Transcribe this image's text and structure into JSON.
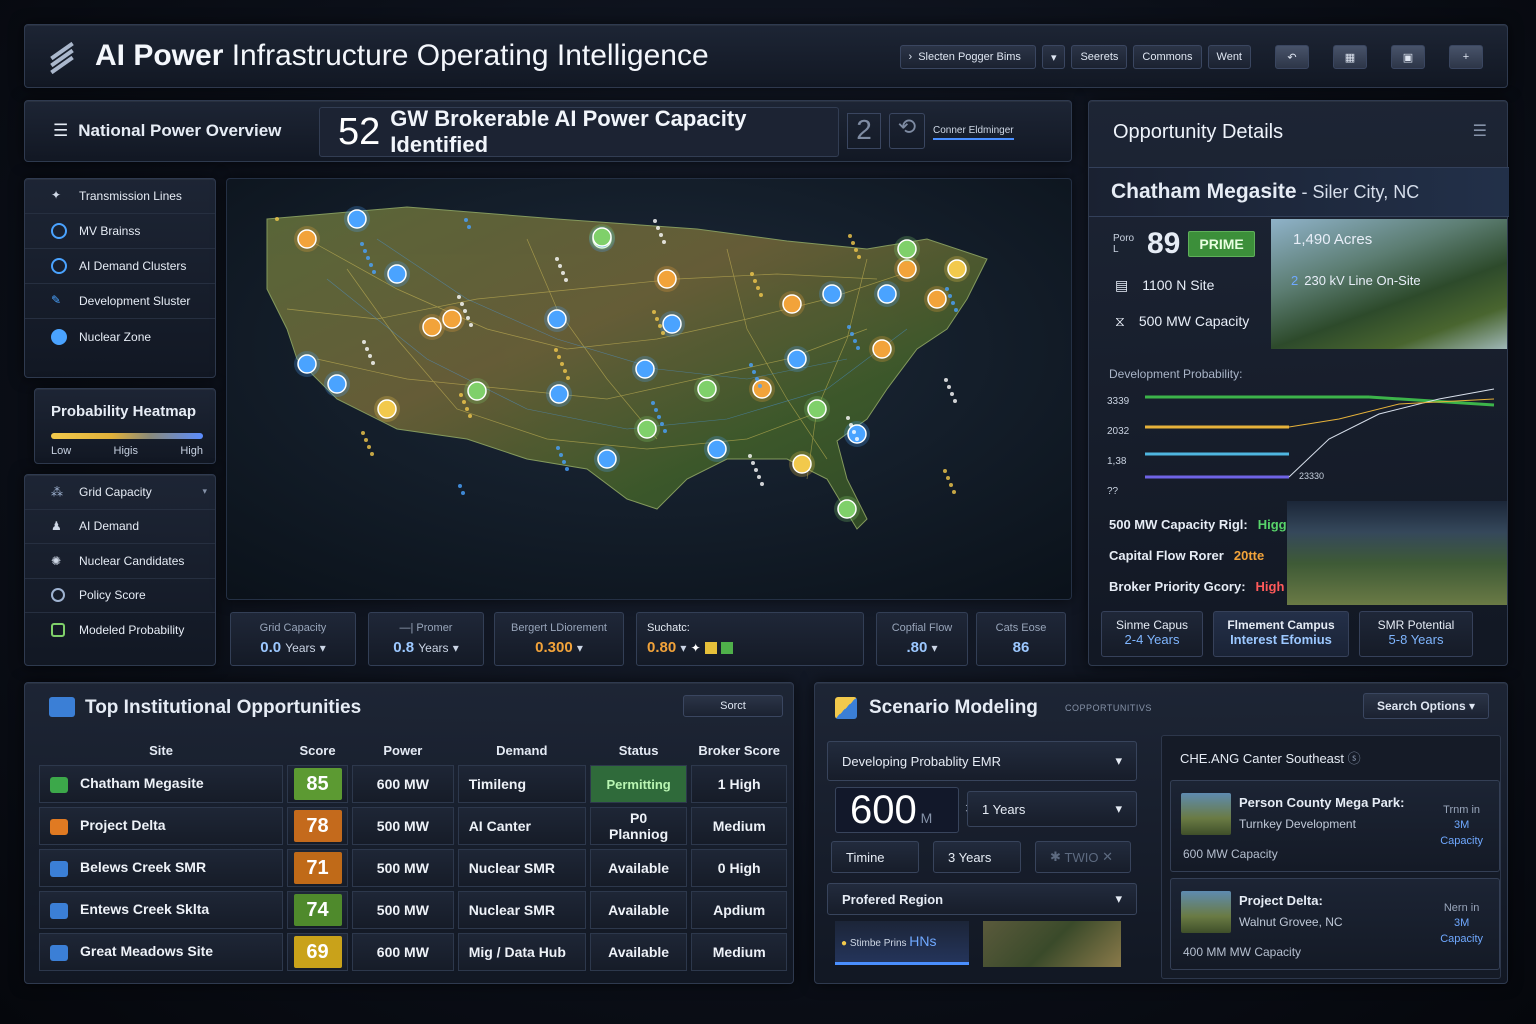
{
  "header": {
    "title_bold": "AI Power",
    "title_rest": " Infrastructure Operating Intelligence",
    "select_label": "Slecten Pogger Bims",
    "btn1": "Seerets",
    "btn2": "Commons",
    "btn3": "Went"
  },
  "overview": {
    "nav_title": "National Power Overview",
    "headline_num": "52",
    "headline_text": "GW Brokerable AI Power Capacity Identified",
    "headline_suffix": "2",
    "sub_label": "Conner Eldminger"
  },
  "layers": [
    {
      "label": "Transmission Lines"
    },
    {
      "label": "MV Brainss"
    },
    {
      "label": "AI Demand Clusters"
    },
    {
      "label": "Development Sluster"
    },
    {
      "label": "Nuclear Zone"
    }
  ],
  "heatmap": {
    "title": "Probability Heatmap",
    "low": "Low",
    "mid": "Higis",
    "high": "High"
  },
  "filters": [
    {
      "label": "Grid Capacity"
    },
    {
      "label": "AI Demand"
    },
    {
      "label": "Nuclear Candidates"
    },
    {
      "label": "Policy Score"
    },
    {
      "label": "Modeled Probability"
    }
  ],
  "metrics": [
    {
      "label": "Grid Capacity",
      "value": "0.0",
      "unit": "Years"
    },
    {
      "label": "—| Promer",
      "value": "0.8",
      "unit": "Years"
    },
    {
      "label": "Bergert LDiorement",
      "value": "0.300",
      "unit": ""
    },
    {
      "label": "Suchatc:",
      "value": "0.80",
      "unit": ""
    },
    {
      "label": "Copfial Flow",
      "value": ".80",
      "unit": ""
    },
    {
      "label": "Cats Eose",
      "value": "86",
      "unit": ""
    }
  ],
  "details": {
    "title": "Opportunity Details",
    "site_name": "Chatham Megasite",
    "site_loc": " - Siler City, NC",
    "score_label": "Poro L",
    "score": "89",
    "badge": "PRIME",
    "acres": "1,490 Acres",
    "site_spec": "1100 N Site",
    "line_spec_num": "2",
    "line_spec": "230 kV Line On-Site",
    "capacity_spec": "500 MW Capacity",
    "prob_title": "Development Probability:",
    "prob_ticks": [
      "3339",
      "2032",
      "1,38",
      "??"
    ],
    "prob_end_label": "23330",
    "kv": [
      {
        "k": "500 MW Capacity Rigl:",
        "v": "Higg",
        "color": "#58d46a"
      },
      {
        "k": "Capital Flow Rorer",
        "v": "20tte",
        "color": "#f2a33a"
      },
      {
        "k": "Broker Priority Gcory:",
        "v": "High",
        "color": "#ff5a5a"
      }
    ],
    "campuses": [
      {
        "name": "Sinme Capus",
        "years": "2-4 Years"
      },
      {
        "name": "Flmement Campus",
        "years": "Interest Efomius"
      },
      {
        "name": "SMR Potential",
        "years": "5-8 Years"
      }
    ]
  },
  "opportunities": {
    "title": "Top Institutional Opportunities",
    "search": "Sorct",
    "columns": [
      "Site",
      "Score",
      "Power",
      "Demand",
      "Status",
      "Broker Score"
    ],
    "rows": [
      {
        "site": "Chatham Megasite",
        "score": "85",
        "score_color": "#5c9a32",
        "icon_color": "#3ca84a",
        "power": "600 MW",
        "demand": "Timileng",
        "status": "Permitting",
        "broker": "1 High"
      },
      {
        "site": "Project Delta",
        "score": "78",
        "score_color": "#c46a1c",
        "icon_color": "#e07a22",
        "power": "500 MW",
        "demand": "AI Canter",
        "status": "P0 Planniog",
        "broker": "Medium"
      },
      {
        "site": "Belews Creek SMR",
        "score": "71",
        "score_color": "#c06a18",
        "icon_color": "#3b7fd6",
        "power": "500 MW",
        "demand": "Nuclear SMR",
        "status": "Available",
        "broker": "0 High"
      },
      {
        "site": "Entews Creek Sklta",
        "score": "74",
        "score_color": "#4f8a2c",
        "icon_color": "#3b7fd6",
        "power": "500 MW",
        "demand": "Nuclear SMR",
        "status": "Available",
        "broker": "Apdium"
      },
      {
        "site": "Great Meadows Site",
        "score": "69",
        "score_color": "#c9a21a",
        "icon_color": "#3b7fd6",
        "power": "600 MW",
        "demand": "Mig / Data Hub",
        "status": "Available",
        "broker": "Medium"
      }
    ]
  },
  "scenario": {
    "title": "Scenario Modeling",
    "subtitle": "COPPORTUNITIVS",
    "search": "Search Options",
    "prob_dropdown": "Developing Probablity EMR",
    "big_value": "600",
    "big_unit": "M",
    "years_dropdown": "1 Years",
    "timing_label": "Timine",
    "timing_value": "3 Years",
    "disabled_label": "TWIO",
    "region_label": "Profered Region",
    "region_sub": "Stimbe Prins",
    "region_code": "HNs",
    "list_title": "CHE.ANG Canter Southeast",
    "cards": [
      {
        "name": "Person County Mega Park:",
        "sub": "Turnkey Development",
        "cap": "600 MW Capacity",
        "r1": "Trnm in",
        "r2": "3M",
        "r3": "Capacity"
      },
      {
        "name": "Project Delta:",
        "sub": "Walnut Grovee, NC",
        "cap": "400 MM MW Capacity",
        "r1": "Nern in",
        "r2": "3M",
        "r3": "Capacity"
      }
    ]
  }
}
